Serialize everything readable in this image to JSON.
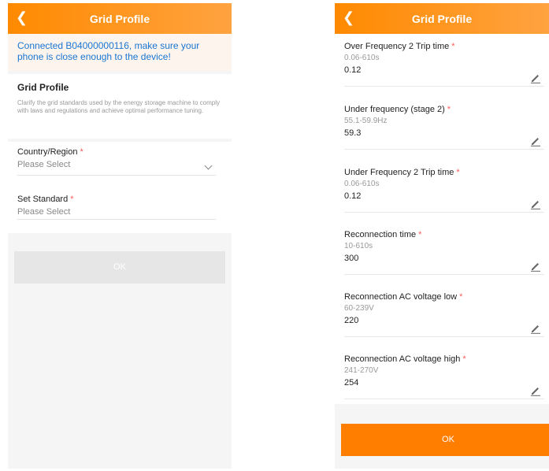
{
  "left": {
    "header": {
      "back_icon": "chevron-left-icon",
      "title": "Grid Profile"
    },
    "banner": "Connected B04000000116, make sure your phone is close enough to the device!",
    "intro": {
      "title": "Grid Profile",
      "description": "Clarify the grid standards used by the energy storage machine to comply with laws and regulations and achieve optimal performance tuning."
    },
    "country": {
      "label": "Country/Region",
      "required": "*",
      "value": "Please Select"
    },
    "standard": {
      "label": "Set Standard",
      "required": "*",
      "value": "Please Select"
    },
    "ok_label": "OK"
  },
  "right": {
    "header": {
      "back_icon": "chevron-left-icon",
      "title": "Grid Profile"
    },
    "fields": [
      {
        "label": "Over Frequency 2 Trip time",
        "required": "*",
        "range": "0.06-610s",
        "value": "0.12"
      },
      {
        "label": "Under frequency (stage 2)",
        "required": "*",
        "range": "55.1-59.9Hz",
        "value": "59.3"
      },
      {
        "label": "Under Frequency 2 Trip time",
        "required": "*",
        "range": "0.06-610s",
        "value": "0.12"
      },
      {
        "label": "Reconnection time",
        "required": "*",
        "range": "10-610s",
        "value": "300"
      },
      {
        "label": "Reconnection AC voltage low",
        "required": "*",
        "range": "60-239V",
        "value": "220"
      },
      {
        "label": "Reconnection AC voltage high",
        "required": "*",
        "range": "241-270V",
        "value": "254"
      }
    ],
    "ok_label": "OK"
  },
  "colors": {
    "accent": "#ff7e00",
    "link": "#1976d2",
    "required": "#ff5a5a"
  }
}
